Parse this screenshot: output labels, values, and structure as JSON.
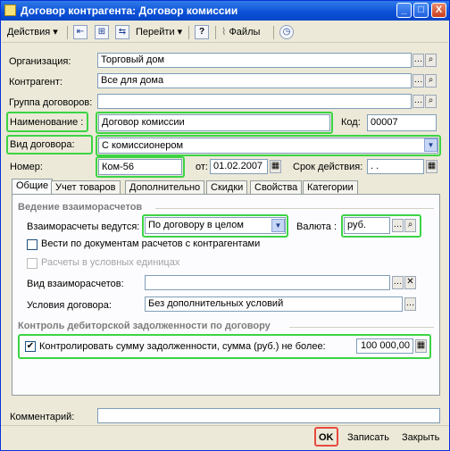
{
  "window": {
    "title": "Договор контрагента: Договор комиссии",
    "controls": [
      "_",
      "□",
      "X"
    ]
  },
  "toolbar": {
    "actions_label": "Действия",
    "goto_label": "Перейти",
    "help_label": "?",
    "files_label": "Файлы"
  },
  "form": {
    "org_label": "Организация:",
    "org_value": "Торговый дом",
    "contractor_label": "Контрагент:",
    "contractor_value": "Все для дома",
    "group_label": "Группа договоров:",
    "group_value": "",
    "name_label": "Наименование :",
    "name_value": "Договор комиссии",
    "code_label": "Код:",
    "code_value": "00007",
    "kind_label": "Вид договора:",
    "kind_value": "С комиссионером",
    "number_label": "Номер:",
    "number_value": "Ком-56",
    "date_label": "от:",
    "date_value": "01.02.2007",
    "term_label": "Срок действия:",
    "term_value": ".  ."
  },
  "tabs": [
    {
      "label": "Общие",
      "active": true
    },
    {
      "label": "Учет товаров"
    },
    {
      "label": "Дополнительно"
    },
    {
      "label": "Скидки"
    },
    {
      "label": "Свойства"
    },
    {
      "label": "Категории"
    }
  ],
  "general": {
    "section_settlements": "Ведение взаиморасчетов",
    "settlements_label": "Взаиморасчеты ведутся:",
    "settlements_value": "По договору в целом",
    "currency_label": "Валюта :",
    "currency_value": "руб.",
    "by_docs_label": "Вести по документам расчетов с контрагентами",
    "by_docs_checked": false,
    "conv_units_label": "Расчеты в условных единицах",
    "conv_units_checked": false,
    "settle_kind_label": "Вид взаиморасчетов:",
    "settle_kind_value": "",
    "conditions_label": "Условия договора:",
    "conditions_value": "Без дополнительных условий",
    "section_debt": "Контроль дебиторской задолженности по договору",
    "debt_control_label": "Контролировать сумму задолженности, сумма (руб.) не более:",
    "debt_control_checked": true,
    "debt_amount": "100 000,00"
  },
  "comment_label": "Комментарий:",
  "comment_value": "",
  "buttons": {
    "ok": "OK",
    "save": "Записать",
    "close": "Закрыть"
  },
  "colors": {
    "highlight_green": "#3cd444",
    "highlight_red": "#e8493f",
    "titlebar_blue": "#0a4fd6"
  }
}
